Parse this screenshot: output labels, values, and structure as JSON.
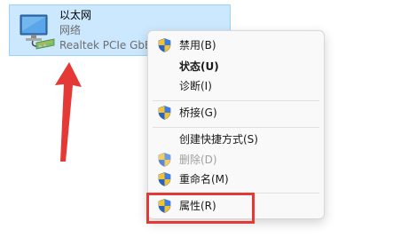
{
  "adapter": {
    "name": "以太网",
    "type": "网络",
    "device": "Realtek PCIe GbE"
  },
  "menu": {
    "items": [
      {
        "label": "禁用(B)",
        "shield": true,
        "bold": false,
        "disabled": false
      },
      {
        "label": "状态(U)",
        "shield": false,
        "bold": true,
        "disabled": false
      },
      {
        "label": "诊断(I)",
        "shield": false,
        "bold": false,
        "disabled": false
      },
      {
        "label": "桥接(G)",
        "shield": true,
        "bold": false,
        "disabled": false
      },
      {
        "label": "创建快捷方式(S)",
        "shield": false,
        "bold": false,
        "disabled": false
      },
      {
        "label": "删除(D)",
        "shield": true,
        "bold": false,
        "disabled": true
      },
      {
        "label": "重命名(M)",
        "shield": true,
        "bold": false,
        "disabled": false
      },
      {
        "label": "属性(R)",
        "shield": true,
        "bold": false,
        "disabled": false
      }
    ]
  },
  "icons": {
    "adapter": "network-adapter-icon",
    "shield": "uac-shield-icon"
  },
  "colors": {
    "selection": "#cce8ff",
    "annotation": "#e53935"
  }
}
